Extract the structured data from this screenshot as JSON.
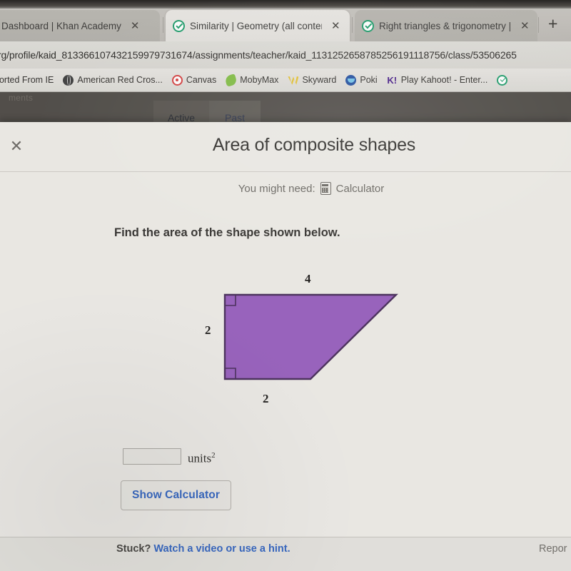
{
  "browser": {
    "tabs": [
      {
        "title": "Dashboard | Khan Academy",
        "close": "✕",
        "favicon": "khan-academy-favicon",
        "active": false
      },
      {
        "title": "Similarity | Geometry (all content",
        "close": "✕",
        "favicon": "khan-academy-favicon",
        "active": true
      },
      {
        "title": "Right triangles & trigonometry |",
        "close": "✕",
        "favicon": "khan-academy-favicon",
        "active": false
      }
    ],
    "new_tab_label": "+",
    "url": "rg/profile/kaid_813366107432159979731674/assignments/teacher/kaid_1131252658785256191118756/class/53506265",
    "bookmarks": [
      {
        "label": "ported From IE",
        "icon": "none"
      },
      {
        "label": "American Red Cros...",
        "icon": "globe-icon"
      },
      {
        "label": "Canvas",
        "icon": "canvas-icon"
      },
      {
        "label": "MobyMax",
        "icon": "mobymax-icon"
      },
      {
        "label": "Skyward",
        "icon": "skyward-icon"
      },
      {
        "label": "Poki",
        "icon": "poki-icon"
      },
      {
        "label": "Play Kahoot! - Enter...",
        "icon": "kahoot-icon"
      },
      {
        "label": "",
        "icon": "khan-academy-icon"
      }
    ]
  },
  "background_page": {
    "ghost_label": "ments",
    "tabs": [
      {
        "label": "Active"
      },
      {
        "label": "Past"
      }
    ]
  },
  "modal": {
    "close_label": "✕",
    "title": "Area of composite shapes",
    "might_need_prefix": "You might need:",
    "calculator_label": "Calculator",
    "question": "Find the area of the shape shown below.",
    "answer": {
      "value": "",
      "placeholder": "",
      "units_text": "units",
      "units_exponent": "2"
    },
    "show_calculator_label": "Show Calculator",
    "footer": {
      "stuck_prefix": "Stuck?",
      "stuck_link": "Watch a video or use a hint.",
      "report_label": "Repor"
    }
  },
  "figure": {
    "type": "trapezoid",
    "fill_color": "#9b5fc4",
    "stroke_color": "#4a2d5e",
    "labels": {
      "top": "4",
      "left": "2",
      "bottom": "2"
    },
    "right_angle_markers": 2,
    "vertices": "top-left, top-right, bottom-right, bottom-left"
  }
}
